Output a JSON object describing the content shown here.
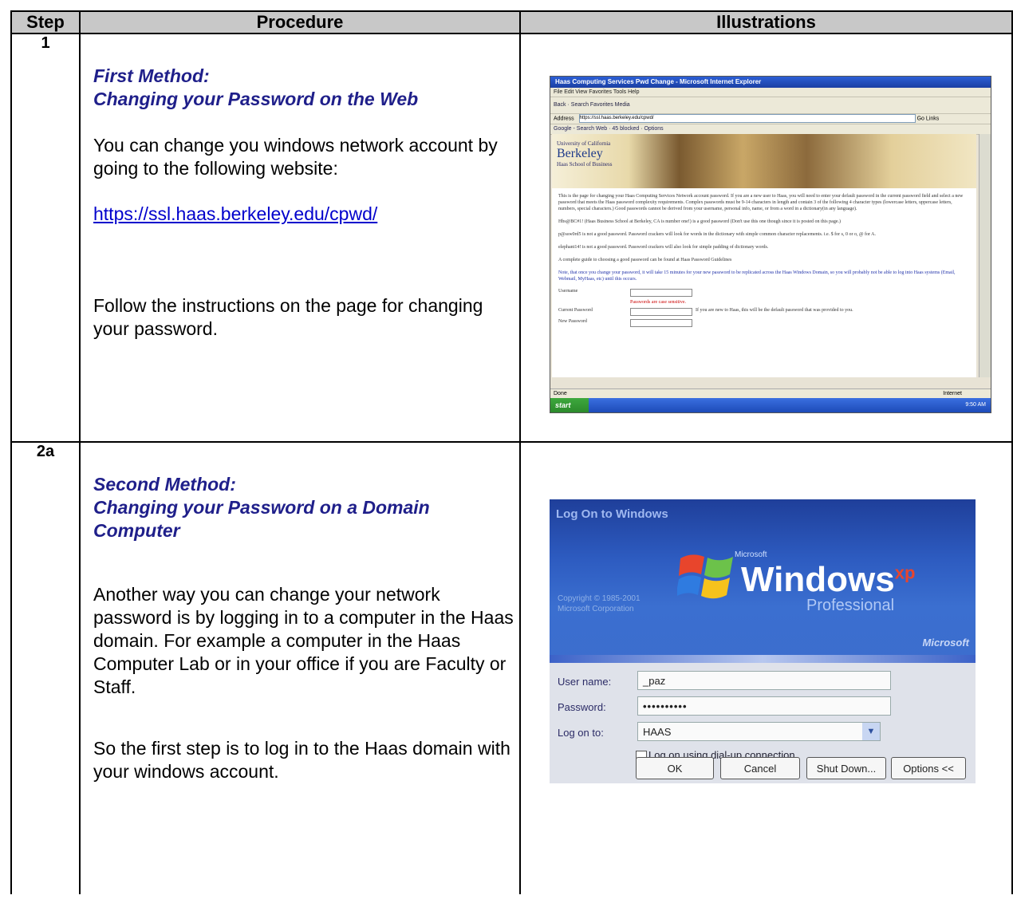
{
  "table": {
    "headers": [
      "Step",
      "Procedure",
      "Illustrations"
    ]
  },
  "rows": [
    {
      "step": "1",
      "heading_line1": "First Method:",
      "heading_line2": "Changing your Password on the Web",
      "paragraph1": "You can change you windows network account by going to the following website:",
      "link": "https://ssl.haas.berkeley.edu/cpwd/",
      "paragraph2": "Follow the  instructions on the page for changing your password."
    },
    {
      "step": "2a",
      "heading_line1": "Second Method:",
      "heading_line2": "Changing your Password on a Domain Computer",
      "paragraph1": "Another way you can change your network password is by logging in to a computer in the Haas domain. For example a computer in the Haas Computer Lab or in your office if you are Faculty or Staff.",
      "paragraph2": "So the first step is to log in to the Haas domain with your windows account."
    }
  ],
  "browser_shot": {
    "title": "Haas Computing Services Pwd Change - Microsoft Internet Explorer",
    "menu": "File   Edit   View   Favorites   Tools   Help",
    "toolbar": "Back  ·  Search  Favorites  Media",
    "address_label": "Address",
    "address": "https://ssl.haas.berkeley.edu/cpwd/",
    "go": "Go",
    "links": "Links",
    "google": "Google -     Search Web  ·  45 blocked  ·  Options",
    "logo_top": "University of California",
    "logo_main": "Berkeley",
    "logo_sub": "Haas School of Business",
    "text1": "This is the page for changing your Haas Computing Services Network account password. If you are a new user to Haas, you will need to enter your default password in the current password field and select a new password that meets the Haas password complexity requirements. Complex passwords must be 9-14 characters in length and contain 3 of the following 4 character types (lowercase letters, uppercase letters, numbers, special characters.) Good passwords cannot be derived from your username, personal info, name, or from a word in a dictionary(in any language).",
    "text2": "Hbs@BC#1! (Haas Business School at Berkeley, CA is number one!) is a good password (Don't use this one though since it is posted on this page.)",
    "text3": "p@ssw0rd5 is not a good password. Password crackers will look for words in the dictionary with simple common character replacements. i.e. $ for s, 0 or o, @ for A.",
    "text4": "elephant14! is not a good password. Password crackers will also look for simple padding of dictionary words.",
    "text5": "A complete guide to choosing a good password can be found at Haas Password Guidelines",
    "text6": "Note, that once you change your password, it will take 15 minutes for your new password to be replicated across the Haas Windows Domain, so you will probably not be able to log into Haas systems (Email, Webmail, MyHaas, etc) until this occurs.",
    "form_username": "Username",
    "form_case": "Passwords are case sensitive.",
    "form_current": "Current Password",
    "form_current_hint": "If you are new to Haas, this will be the default password that was provided to you.",
    "form_new": "New Password",
    "status": "Done",
    "status_right": "Internet",
    "start": "start",
    "tray_time": "9:50 AM"
  },
  "logon_shot": {
    "title": "Log On to Windows",
    "microsoft_small": "Microsoft",
    "windows": "Windows",
    "xp": "xp",
    "professional": "Professional",
    "copyright1": "Copyright © 1985-2001",
    "copyright2": "Microsoft Corporation",
    "microsoft": "Microsoft",
    "user_label": "User name:",
    "user_value": "_paz",
    "password_label": "Password:",
    "password_value": "••••••••••",
    "logon_label": "Log on to:",
    "logon_value": "HAAS",
    "dialup": "Log on using dial-up connection",
    "ok": "OK",
    "cancel": "Cancel",
    "shutdown": "Shut Down...",
    "options": "Options <<"
  }
}
